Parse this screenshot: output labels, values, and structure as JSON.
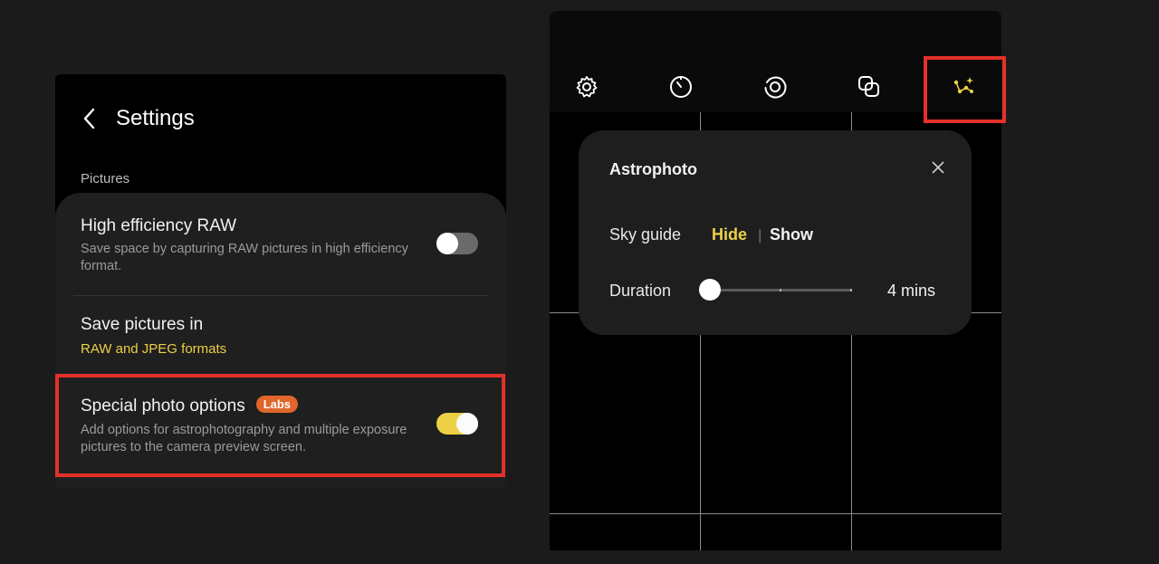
{
  "settings": {
    "title": "Settings",
    "back_icon": "back-chevron-icon",
    "section_label": "Pictures",
    "rows": [
      {
        "title": "High efficiency RAW",
        "description": "Save space by capturing RAW pictures in high efficiency format.",
        "toggle": "off"
      },
      {
        "title": "Save pictures in",
        "subtitle": "RAW and JPEG formats"
      },
      {
        "title": "Special photo options",
        "badge": "Labs",
        "description": "Add options for astrophotography and multiple exposure pictures to the camera preview screen.",
        "toggle": "on"
      }
    ]
  },
  "camera": {
    "toolbar_icons": [
      "settings-gear-icon",
      "timer-icon",
      "motion-photo-icon",
      "filters-icon",
      "astrophoto-icon"
    ],
    "astrophoto": {
      "title": "Astrophoto",
      "close_icon": "close-icon",
      "sky_guide_label": "Sky guide",
      "sky_guide_hide": "Hide",
      "sky_guide_separator": "|",
      "sky_guide_show": "Show",
      "sky_guide_selected": "Hide",
      "duration_label": "Duration",
      "duration_value": "4 mins",
      "duration_slider_level": 0
    }
  },
  "colors": {
    "accent_yellow": "#ecd046",
    "highlight_red": "#e3312a",
    "labs_badge": "#e0662c"
  }
}
